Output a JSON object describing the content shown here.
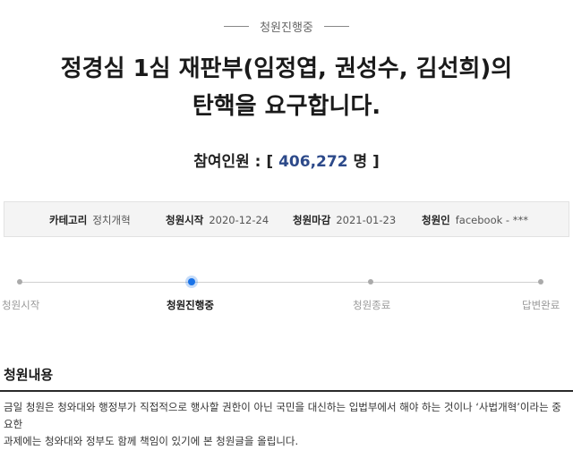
{
  "status": {
    "label": "청원진행중"
  },
  "title": {
    "line1": "정경심 1심 재판부(임정엽, 권성수, 김선희)의",
    "line2": "탄핵을 요구합니다."
  },
  "participants": {
    "label": "참여인원 : [",
    "count": "406,272",
    "unit": "명 ]"
  },
  "info": {
    "category_label": "카테고리",
    "category_value": "정치개혁",
    "start_label": "청원시작",
    "start_value": "2020-12-24",
    "end_label": "청원마감",
    "end_value": "2021-01-23",
    "author_label": "청원인",
    "author_value": "facebook - ***"
  },
  "progress": {
    "steps": [
      "청원시작",
      "청원진행중",
      "청원종료",
      "답변완료"
    ],
    "active_index": 1
  },
  "content": {
    "heading": "청원내용",
    "line1": "금일 청원은 청와대와 행정부가 직접적으로 행사할 권한이 아닌 국민을 대신하는 입법부에서 해야 하는 것이나 ‘사법개혁’이라는 중요한",
    "line2": "과제에는 청와대와 정부도 함께 책임이 있기에 본 청원글을 올립니다."
  }
}
